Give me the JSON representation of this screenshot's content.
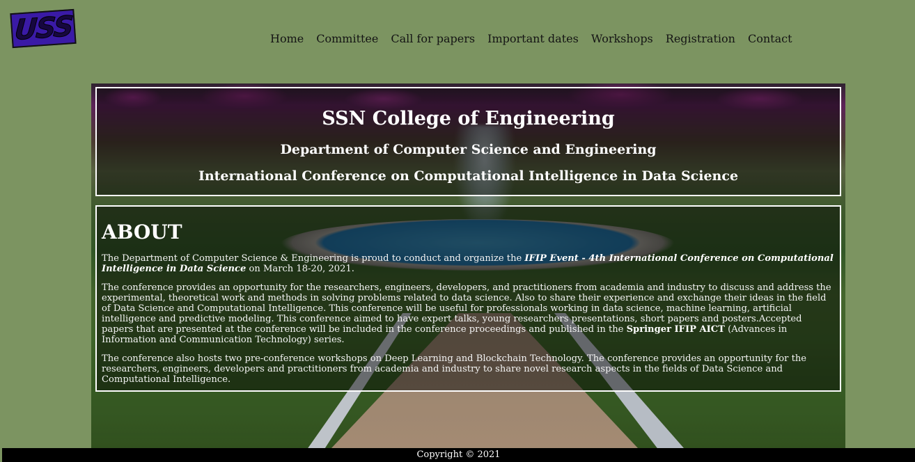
{
  "logo": {
    "text": "USS"
  },
  "nav": {
    "items": [
      "Home",
      "Committee",
      "Call for papers",
      "Important dates",
      "Workshops",
      "Registration",
      "Contact"
    ]
  },
  "hero": {
    "title": "SSN College of Engineering",
    "department": "Department of Computer Science and Engineering",
    "conference": "International Conference on Computational Intelligence in Data Science"
  },
  "about": {
    "heading": "ABOUT",
    "p1_pre": "The Department of Computer Science & Engineering is proud to conduct and organize the ",
    "p1_event": "IFIP Event - 4th International Conference on Computational Intelligence in Data Science",
    "p1_post": " on March 18-20, 2021.",
    "p2_pre": "The conference provides an opportunity for the researchers, engineers, developers, and practitioners from academia and industry to discuss and address the experimental, theoretical work and methods in solving problems related to data science. Also to share their experience and exchange their ideas in the field of Data Science and Computational Intelligence. This conference will be useful for professionals working in data science, machine learning, artificial intelligence and predictive modeling. This conference aimed to have expert talks, young researchers presentations, short papers and posters.Accepted papers that are presented at the conference will be included in the conference proceedings and published in the ",
    "p2_bold": "Springer IFIP AICT",
    "p2_post": " (Advances in Information and Communication Technology) series.",
    "p3": "The conference also hosts two pre-conference workshops on Deep Learning and Blockchain Technology. The conference provides an opportunity for the researchers, engineers, developers and practitioners from academia and industry to share novel research aspects in the fields of Data Science and Computational Intelligence."
  },
  "footer": {
    "copyright": "Copyright © 2021"
  }
}
